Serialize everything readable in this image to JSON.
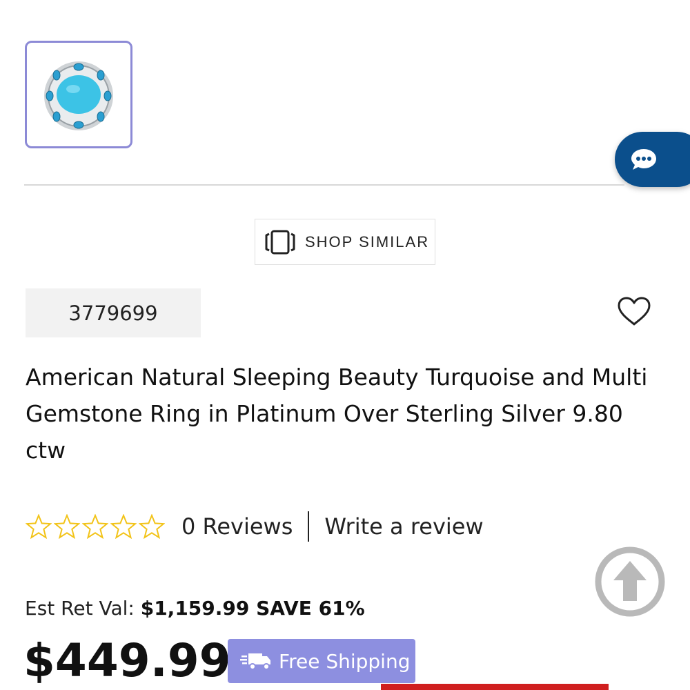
{
  "gallery": {
    "thumbnail_icon": "ring-turquoise-image"
  },
  "chat": {
    "icon": "chat-bubble-icon"
  },
  "shop_similar": {
    "label": "SHOP SIMILAR",
    "icon": "similar-cards-icon"
  },
  "product": {
    "sku": "3779699",
    "title": "American Natural Sleeping Beauty Turquoise and Multi Gemstone Ring in Platinum Over Sterling Silver 9.80 ctw",
    "rating_stars": 0,
    "reviews_label": "0 Reviews",
    "write_review_label": "Write a review",
    "est_ret_val_label": "Est Ret Val:",
    "est_ret_val": "$1,159.99 SAVE 61%",
    "price": "$449.99",
    "free_shipping_label": "Free Shipping"
  },
  "colors": {
    "accent_blue": "#0b4f8c",
    "free_shipping_bg": "#8d8fe0",
    "star_color": "#f2c318",
    "thumb_border": "#8c8ad6",
    "red_bar": "#d01f1f"
  }
}
